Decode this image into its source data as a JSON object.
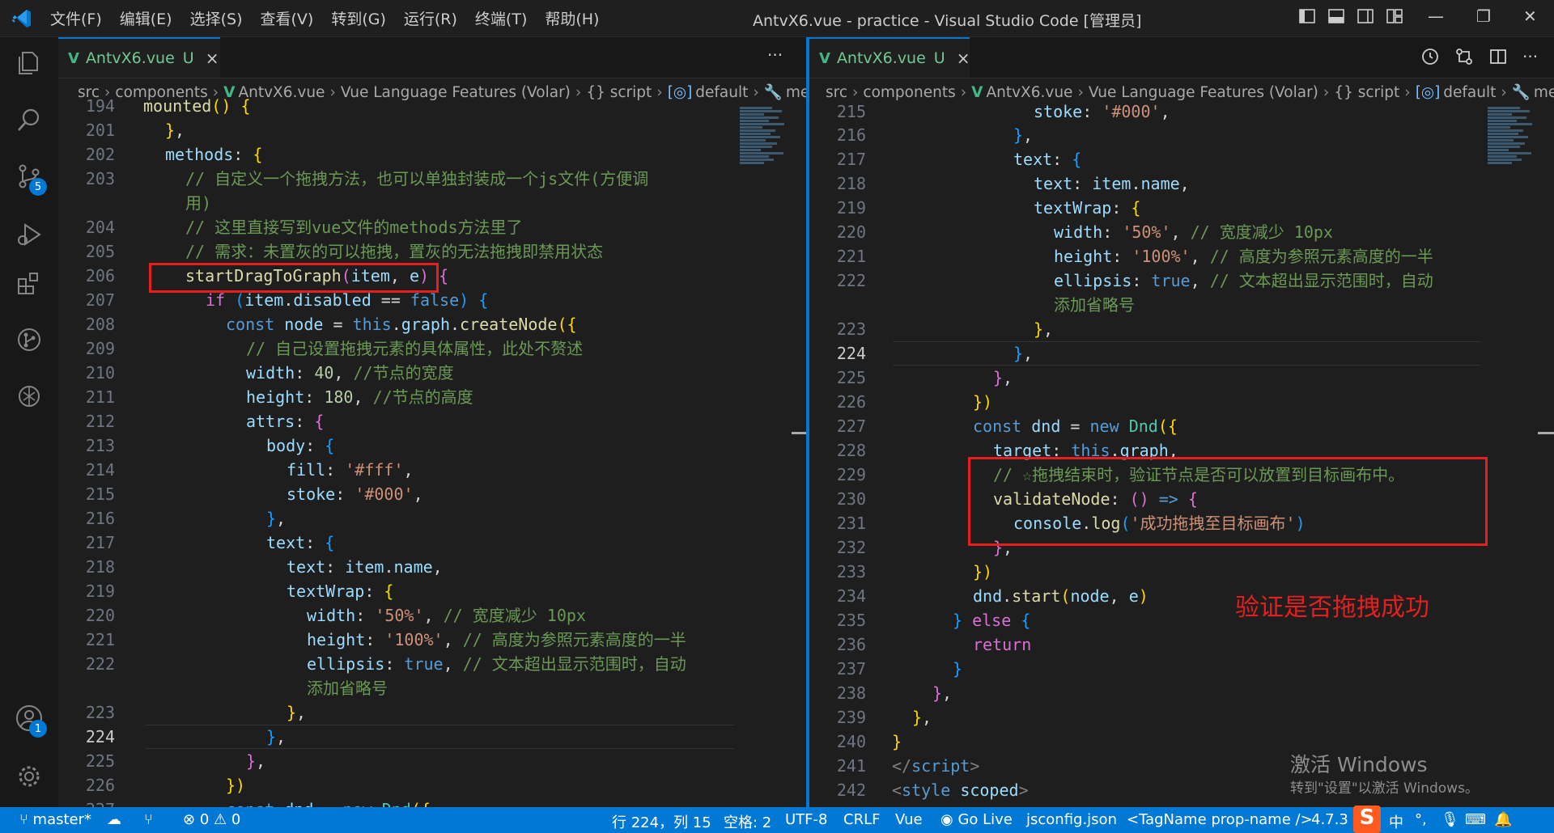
{
  "window": {
    "title": "AntvX6.vue - practice - Visual Studio Code [管理员]",
    "menu": [
      "文件(F)",
      "编辑(E)",
      "选择(S)",
      "查看(V)",
      "转到(G)",
      "运行(R)",
      "终端(T)",
      "帮助(H)"
    ]
  },
  "activity": {
    "scm_badge": "5",
    "account_badge": "1"
  },
  "left_editor": {
    "tab": {
      "name": "AntvX6.vue",
      "status": "U",
      "close": "×"
    },
    "more": "···",
    "breadcrumb": [
      "src",
      "components",
      "AntvX6.vue",
      "Vue Language Features (Volar)",
      "{} script",
      "default",
      "meth"
    ],
    "annotation_box_text": "startDragToGraph(item, e)"
  },
  "right_editor": {
    "tab": {
      "name": "AntvX6.vue",
      "status": "U",
      "close": "×"
    },
    "breadcrumb": [
      "src",
      "components",
      "AntvX6.vue",
      "Vue Language Features (Volar)",
      "{} script",
      "default",
      "meth"
    ],
    "annotation_label": "验证是否拖拽成功"
  },
  "watermark": {
    "line1": "激活 Windows",
    "line2": "转到\"设置\"以激活 Windows。"
  },
  "status": {
    "branch": "master*",
    "errors": "0",
    "warnings": "0",
    "position": "行 224，列 15",
    "spaces": "空格: 2",
    "encoding": "UTF-8",
    "eol": "CRLF",
    "language": "Vue",
    "golive": "Go Live",
    "jsconfig": "jsconfig.json",
    "tagname": "<TagName prop-name />",
    "version": "4.7.3",
    "ime": "中"
  },
  "colors": {
    "accent": "#0078d4",
    "annotation": "#e51f1f",
    "vue": "#41b883"
  }
}
